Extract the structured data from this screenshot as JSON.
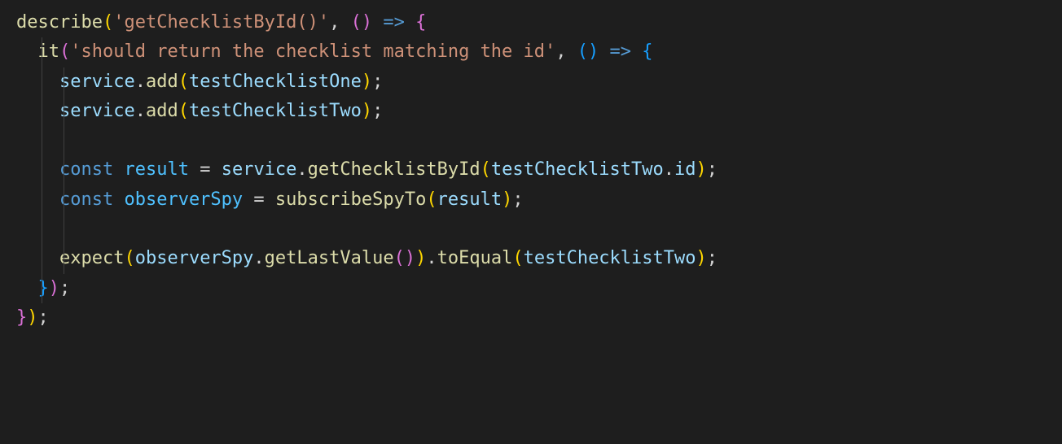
{
  "code": {
    "l1": {
      "describe": "describe",
      "str": "'getChecklistById()'"
    },
    "l2": {
      "it": "it",
      "str": "'should return the checklist matching the id'"
    },
    "l3": {
      "svc": "service",
      "add": "add",
      "arg": "testChecklistOne"
    },
    "l4": {
      "svc": "service",
      "add": "add",
      "arg": "testChecklistTwo"
    },
    "l6": {
      "kw": "const",
      "name": "result",
      "svc": "service",
      "method": "getChecklistById",
      "arg": "testChecklistTwo",
      "prop": "id"
    },
    "l7": {
      "kw": "const",
      "name": "observerSpy",
      "fn": "subscribeSpyTo",
      "arg": "result"
    },
    "l9": {
      "expect": "expect",
      "obj": "observerSpy",
      "getLast": "getLastValue",
      "toEqual": "toEqual",
      "arg": "testChecklistTwo"
    }
  }
}
